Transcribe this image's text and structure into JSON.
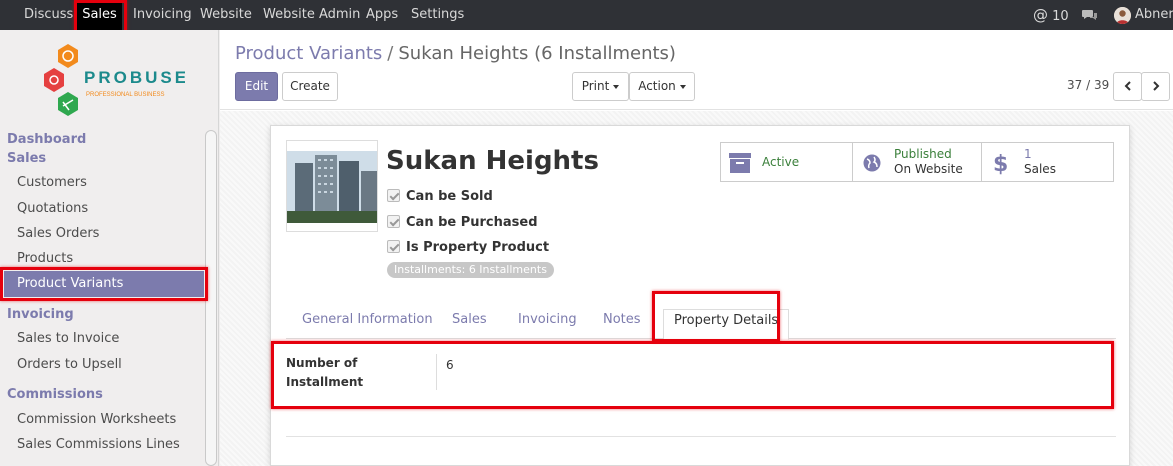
{
  "topbar": {
    "menus": [
      "Discuss",
      "Sales",
      "Invoicing",
      "Website",
      "Website Admin",
      "Apps",
      "Settings"
    ],
    "notifications_count": "10",
    "user_name": "Abner"
  },
  "logo": {
    "brand": "PROBUSE",
    "tagline": "PROFESSIONAL BUSINESS"
  },
  "sidebar": {
    "dashboard": "Dashboard",
    "sales_section": "Sales",
    "sales_items": [
      "Customers",
      "Quotations",
      "Sales Orders",
      "Products",
      "Product Variants"
    ],
    "invoicing_section": "Invoicing",
    "invoicing_items": [
      "Sales to Invoice",
      "Orders to Upsell"
    ],
    "commissions_section": "Commissions",
    "commissions_items": [
      "Commission Worksheets",
      "Sales Commissions Lines"
    ]
  },
  "breadcrumb": {
    "parent": "Product Variants",
    "separator": "/",
    "current": "Sukan Heights (6 Installments)"
  },
  "buttons": {
    "edit": "Edit",
    "create": "Create",
    "print": "Print",
    "action": "Action"
  },
  "pager": {
    "text": "37 / 39"
  },
  "record": {
    "name": "Sukan Heights",
    "checks": [
      "Can be Sold",
      "Can be Purchased",
      "Is Property Product"
    ],
    "tag": "Installments: 6 Installments",
    "stat_active": "Active",
    "stat_published_1": "Published",
    "stat_published_2": "On Website",
    "stat_sales_count": "1",
    "stat_sales_label": "Sales"
  },
  "tabs": [
    "General Information",
    "Sales",
    "Invoicing",
    "Notes",
    "Property Details"
  ],
  "active_tab": "Property Details",
  "property_details": {
    "label_line1": "Number of",
    "label_line2": "Installment",
    "value": "6"
  },
  "colors": {
    "accent": "#7c7bad",
    "highlight": "#e5000d",
    "topbar": "#2f3136",
    "active_green": "#3a7f3a"
  }
}
